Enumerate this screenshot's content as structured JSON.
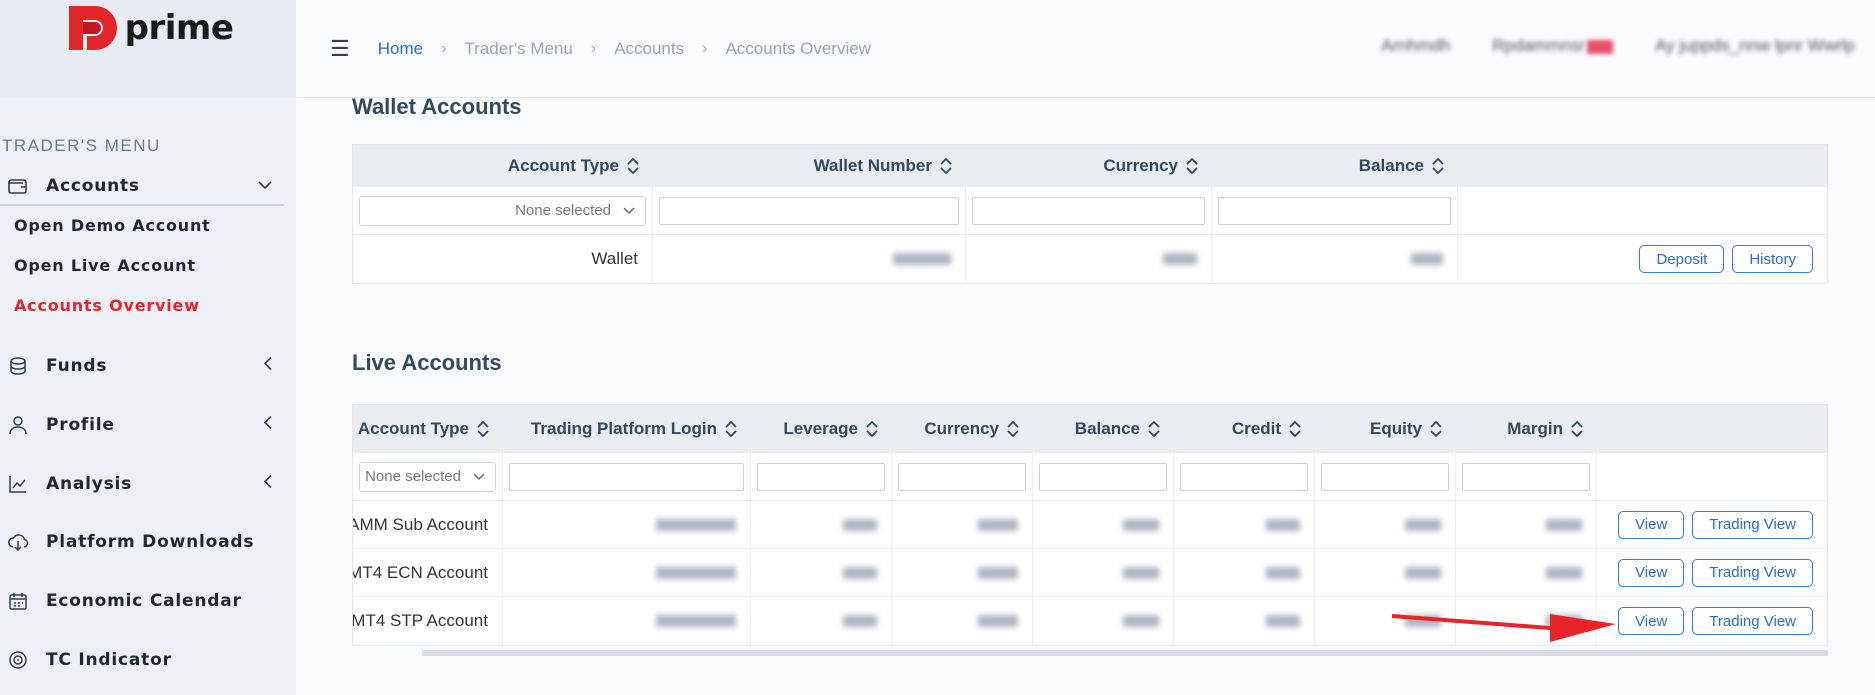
{
  "brand": {
    "name": "prime",
    "accent": "#e0262b"
  },
  "header": {
    "breadcrumbs": [
      "Home",
      "Trader's Menu",
      "Accounts",
      "Accounts Overview"
    ],
    "user_items": [
      "Arnhmdh",
      "Rpdammnsr",
      "Ay juppds_nnw lpnr Wwrlp"
    ]
  },
  "sidebar": {
    "section_label": "TRADER'S MENU",
    "accounts_label": "Accounts",
    "sub_items": [
      "Open Demo Account",
      "Open Live Account",
      "Accounts Overview"
    ],
    "items": [
      "Funds",
      "Profile",
      "Analysis",
      "Platform Downloads",
      "Economic Calendar",
      "TC Indicator"
    ]
  },
  "wallet": {
    "title": "Wallet Accounts",
    "columns": [
      "Account Type",
      "Wallet Number",
      "Currency",
      "Balance"
    ],
    "filter_placeholder": "None selected",
    "rows": [
      {
        "type": "Wallet"
      }
    ],
    "buttons": [
      "Deposit",
      "History"
    ]
  },
  "live": {
    "title": "Live Accounts",
    "columns": [
      "Account Type",
      "Trading Platform Login",
      "Leverage",
      "Currency",
      "Balance",
      "Credit",
      "Equity",
      "Margin"
    ],
    "filter_placeholder": "None selected",
    "rows": [
      {
        "type": "AMM Sub Account"
      },
      {
        "type": "MT4 ECN Account"
      },
      {
        "type": "MT4 STP Account"
      }
    ],
    "buttons": [
      "View",
      "Trading View"
    ]
  }
}
